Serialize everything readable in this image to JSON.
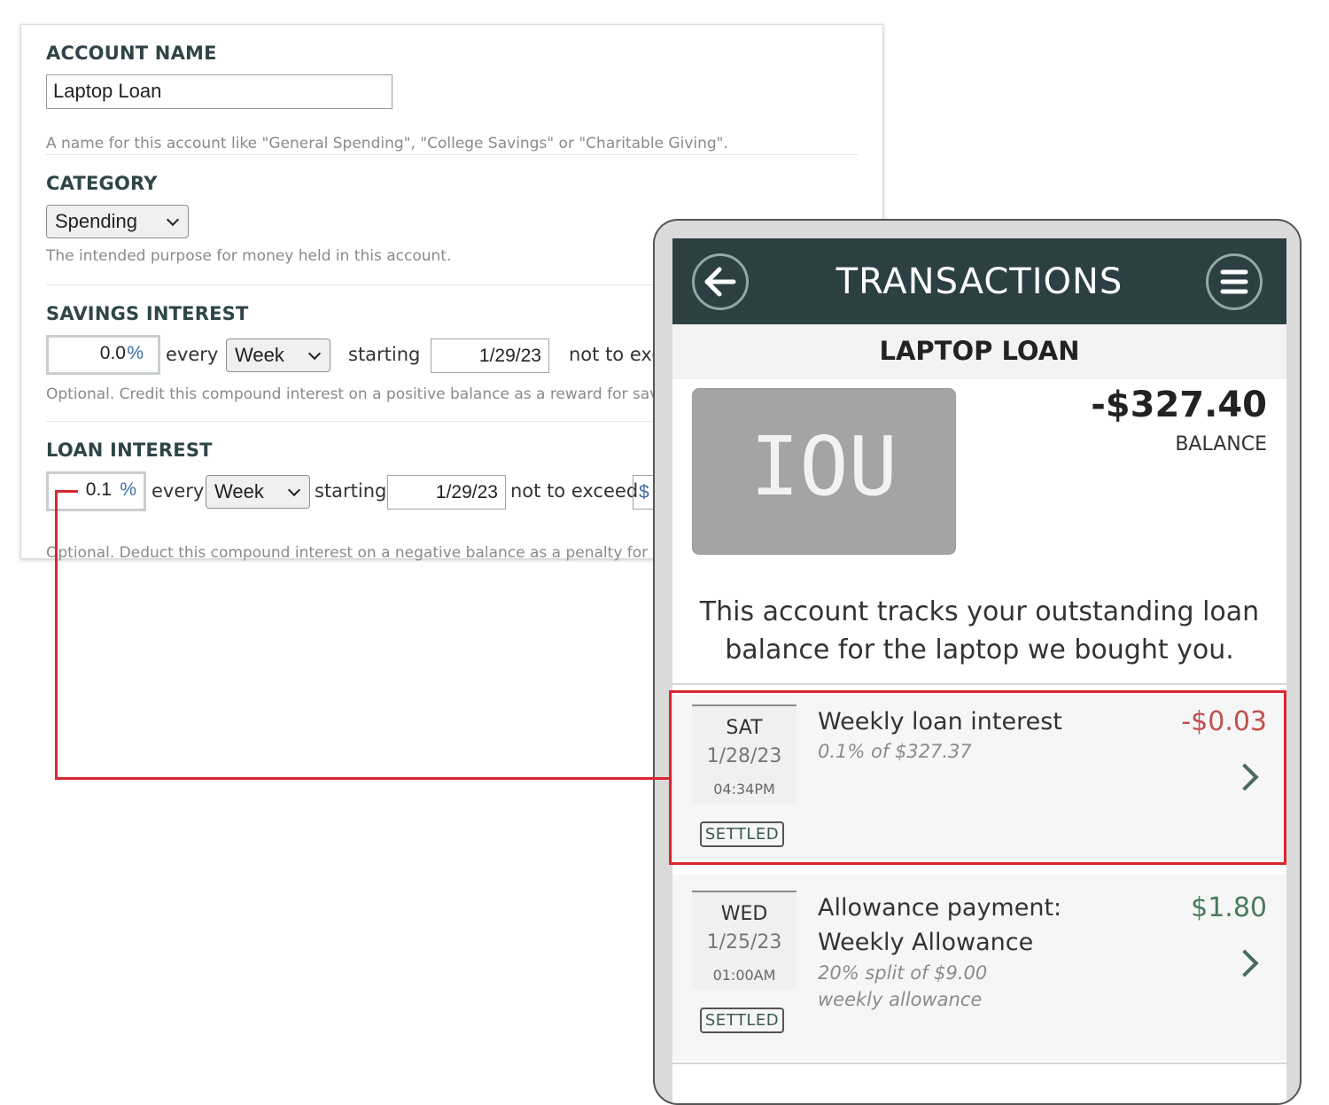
{
  "form": {
    "account_name": {
      "title": "ACCOUNT NAME",
      "value": "Laptop Loan",
      "help": "A name for this account like \"General Spending\", \"College Savings\" or \"Charitable Giving\"."
    },
    "category": {
      "title": "CATEGORY",
      "value": "Spending",
      "help": "The intended purpose for money held in this account."
    },
    "savings_interest": {
      "title": "SAVINGS INTEREST",
      "rate": "0.0",
      "pct": "%",
      "every": "every",
      "period": "Week",
      "starting": "starting",
      "start_date": "1/29/23",
      "not_to_exceed": "not to exc",
      "help": "Optional. Credit this compound interest on a positive balance as a reward for sav"
    },
    "loan_interest": {
      "title": "LOAN INTEREST",
      "rate": "0.1",
      "pct": "%",
      "every": "every",
      "period": "Week",
      "starting": "starting",
      "start_date": "1/29/23",
      "not_to_exceed": "not to exceed",
      "dollar": "$",
      "help": "Optional. Deduct this compound interest on a negative balance as a penalty for b"
    }
  },
  "phone": {
    "appbar_title": "TRANSACTIONS",
    "account_title": "LAPTOP LOAN",
    "card_text": "IOU",
    "balance": "-$327.40",
    "balance_label": "BALANCE",
    "description": "This account tracks your outstanding loan balance for the laptop we bought you.",
    "transactions": [
      {
        "dow": "SAT",
        "date": "1/28/23",
        "time": "04:34PM",
        "status": "SETTLED",
        "title": "Weekly loan interest",
        "subtitle": "0.1% of $327.37",
        "amount": "-$0.03",
        "amount_color": "#c0504d"
      },
      {
        "dow": "WED",
        "date": "1/25/23",
        "time": "01:00AM",
        "status": "SETTLED",
        "title": "Allowance payment: Weekly Allowance",
        "subtitle": "20% split of $9.00 weekly allowance",
        "amount": "$1.80",
        "amount_color": "#4a7a5c"
      }
    ]
  },
  "colors": {
    "appbar": "#2c3f43",
    "annotation": "#d9272e",
    "heading": "#2f4548"
  }
}
